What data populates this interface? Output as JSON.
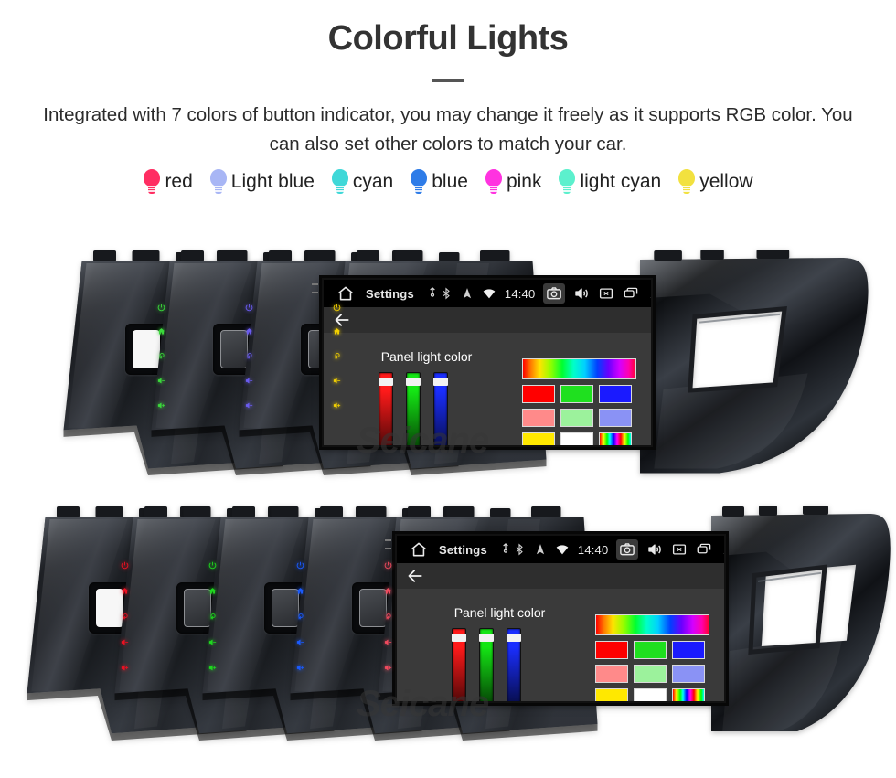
{
  "header": {
    "title": "Colorful Lights",
    "subtitle": "Integrated with 7 colors of button indicator, you may change it freely as it supports RGB color. You can also set other colors to match your car."
  },
  "legend": {
    "items": [
      {
        "label": "red",
        "color": "#ff2d62",
        "icon": "bulb-icon"
      },
      {
        "label": "Light blue",
        "color": "#a8b6f5",
        "icon": "bulb-icon"
      },
      {
        "label": "cyan",
        "color": "#3fd8d8",
        "icon": "bulb-icon"
      },
      {
        "label": "blue",
        "color": "#2e7ce8",
        "icon": "bulb-icon"
      },
      {
        "label": "pink",
        "color": "#ff33e0",
        "icon": "bulb-icon"
      },
      {
        "label": "light cyan",
        "color": "#5cf0cd",
        "icon": "bulb-icon"
      },
      {
        "label": "yellow",
        "color": "#f2e13f",
        "icon": "bulb-icon"
      }
    ]
  },
  "watermark": {
    "text": "Seicane"
  },
  "screen": {
    "statusbar": {
      "home_icon": "home-icon",
      "title": "Settings",
      "pin_icon": "location-pin-icon",
      "bluetooth_icon": "bluetooth-icon",
      "gps_icon": "gps-icon",
      "wifi_icon": "wifi-icon",
      "clock": "14:40",
      "camera_icon": "camera-icon",
      "volume_icon": "volume-icon",
      "close_icon": "close-box-icon",
      "recents_icon": "recents-icon",
      "back_icon": "back-arrow-icon"
    },
    "appbar": {
      "back_icon": "back-arrow-icon"
    },
    "panel": {
      "title": "Panel light color",
      "sliders": [
        {
          "name": "red-channel-slider",
          "color": "#ff1a1a",
          "value": 96
        },
        {
          "name": "green-channel-slider",
          "color": "#14e614",
          "value": 96
        },
        {
          "name": "blue-channel-slider",
          "color": "#1a2eff",
          "value": 96
        }
      ],
      "spectrum_bar": "spectrum",
      "swatch_rows": [
        [
          "#ff0000",
          "#1fe01f",
          "#1a1aff"
        ],
        [
          "#ff8a8a",
          "#9cf29c",
          "#8a92f5"
        ],
        [
          "#ffe800",
          "#ffffff",
          "rainbow"
        ]
      ]
    }
  },
  "rows": {
    "top": {
      "units": [
        {
          "name": "bezel-blank",
          "button_color": "none"
        },
        {
          "name": "bezel-green-light",
          "button_color": "#3bd93b"
        },
        {
          "name": "bezel-purple-light",
          "button_color": "#6b5cf0"
        },
        {
          "name": "bezel-yellow-light",
          "button_color": "#f2d000"
        }
      ]
    },
    "bottom": {
      "units": [
        {
          "name": "bezel-blank",
          "button_color": "none"
        },
        {
          "name": "bezel-red-light",
          "button_color": "#ee1122"
        },
        {
          "name": "bezel-green-light",
          "button_color": "#1fd81f"
        },
        {
          "name": "bezel-blue-light",
          "button_color": "#1a5bff"
        },
        {
          "name": "bezel-pink-light",
          "button_color": "#f04a5e"
        }
      ]
    }
  },
  "side_buttons": [
    {
      "name": "power-button",
      "icon": "power-icon"
    },
    {
      "name": "home-button",
      "icon": "home-outline-icon"
    },
    {
      "name": "back-button",
      "icon": "return-arrow-icon"
    },
    {
      "name": "volume-down-button",
      "icon": "volume-minus-icon"
    },
    {
      "name": "volume-up-button",
      "icon": "volume-plus-icon"
    }
  ]
}
